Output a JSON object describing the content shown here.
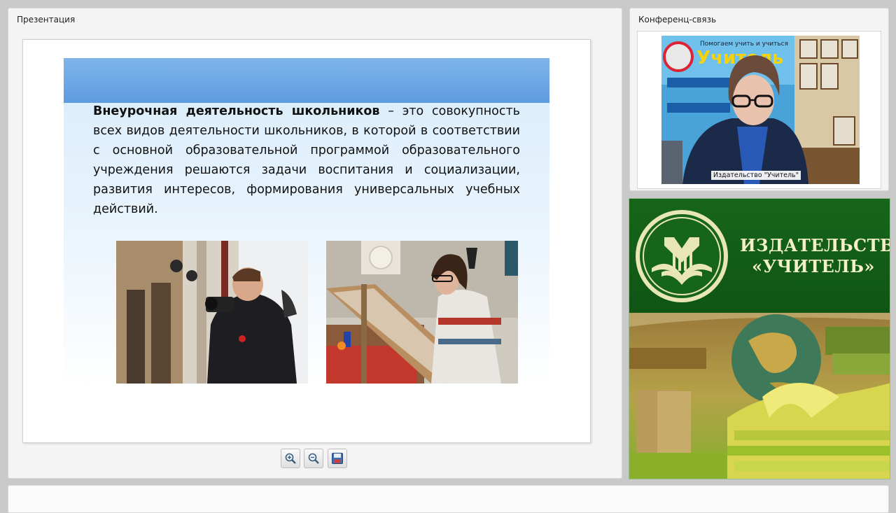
{
  "presentation": {
    "title": "Презентация",
    "slide": {
      "definition_term": "Внеурочная деятельность школьников",
      "definition_body": " – это совокупность всех видов деятельности школьников, в которой в соответствии с основной образовательной программой образовательного учреждения решаются задачи воспитания и социализации, развития интересов, формирования универсальных учебных действий."
    },
    "toolbar": {
      "zoom_in_icon": "zoom-in-icon",
      "zoom_out_icon": "zoom-out-icon",
      "save_icon": "save-icon"
    }
  },
  "conference": {
    "title": "Конференц-связь",
    "video_caption": "Издательство \"Учитель\""
  },
  "brand": {
    "name_line1": "ИЗДАТЕЛЬСТВО",
    "name_line2": "«УЧИТЕЛЬ»",
    "colors": {
      "green": "#17651a",
      "cream": "#f3efc8"
    }
  }
}
